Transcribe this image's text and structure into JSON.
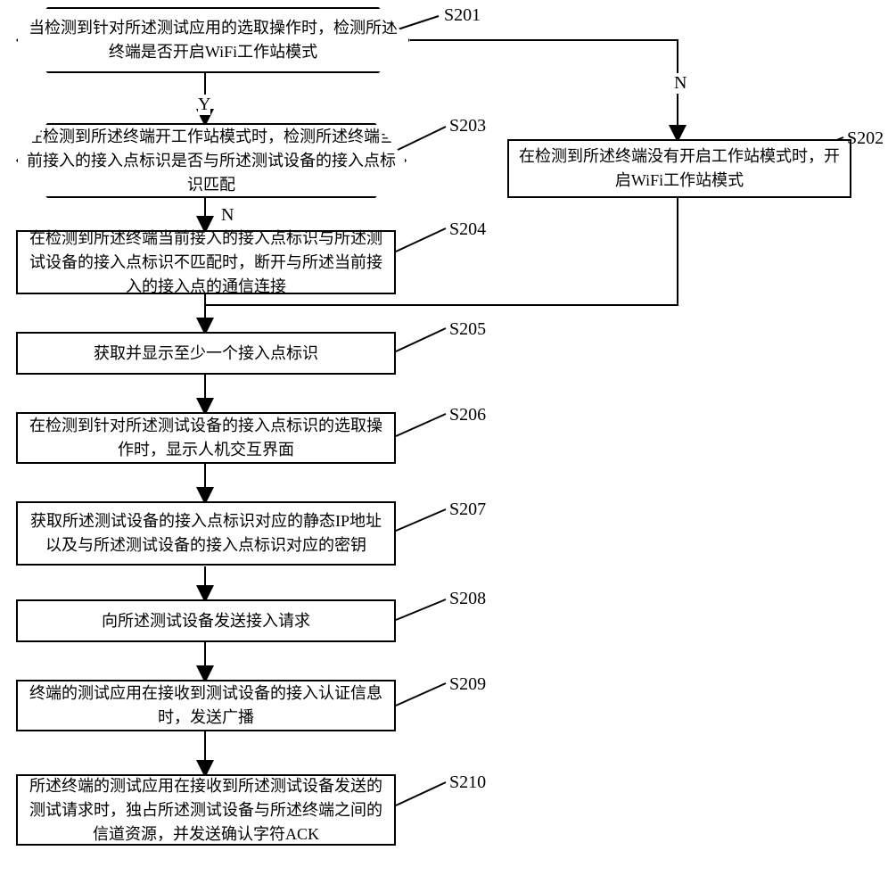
{
  "steps": {
    "s201": {
      "id": "S201",
      "text": "当检测到针对所述测试应用的选取操作时，检测所述终端是否开启WiFi工作站模式"
    },
    "s202": {
      "id": "S202",
      "text": "在检测到所述终端没有开启工作站模式时，开启WiFi工作站模式"
    },
    "s203": {
      "id": "S203",
      "text": "在检测到所述终端开工作站模式时，检测所述终端当前接入的接入点标识是否与所述测试设备的接入点标识匹配"
    },
    "s204": {
      "id": "S204",
      "text": "在检测到所述终端当前接入的接入点标识与所述测试设备的接入点标识不匹配时，断开与所述当前接入的接入点的通信连接"
    },
    "s205": {
      "id": "S205",
      "text": "获取并显示至少一个接入点标识"
    },
    "s206": {
      "id": "S206",
      "text": "在检测到针对所述测试设备的接入点标识的选取操作时，显示人机交互界面"
    },
    "s207": {
      "id": "S207",
      "text": "获取所述测试设备的接入点标识对应的静态IP地址以及与所述测试设备的接入点标识对应的密钥"
    },
    "s208": {
      "id": "S208",
      "text": "向所述测试设备发送接入请求"
    },
    "s209": {
      "id": "S209",
      "text": "终端的测试应用在接收到测试设备的接入认证信息时，发送广播"
    },
    "s210": {
      "id": "S210",
      "text": "所述终端的测试应用在接收到所述测试设备发送的测试请求时，独占所述测试设备与所述终端之间的信道资源，并发送确认字符ACK"
    }
  },
  "labels": {
    "yes": "Y",
    "no": "N"
  },
  "chart_data": {
    "type": "table",
    "description": "Flowchart of WiFi test application connection procedure",
    "nodes": [
      {
        "id": "S201",
        "kind": "decision",
        "text": "当检测到针对所述测试应用的选取操作时，检测所述终端是否开启WiFi工作站模式"
      },
      {
        "id": "S202",
        "kind": "process",
        "text": "在检测到所述终端没有开启工作站模式时，开启WiFi工作站模式"
      },
      {
        "id": "S203",
        "kind": "decision",
        "text": "在检测到所述终端开工作站模式时，检测所述终端当前接入的接入点标识是否与所述测试设备的接入点标识匹配"
      },
      {
        "id": "S204",
        "kind": "process",
        "text": "在检测到所述终端当前接入的接入点标识与所述测试设备的接入点标识不匹配时，断开与所述当前接入的接入点的通信连接"
      },
      {
        "id": "S205",
        "kind": "process",
        "text": "获取并显示至少一个接入点标识"
      },
      {
        "id": "S206",
        "kind": "process",
        "text": "在检测到针对所述测试设备的接入点标识的选取操作时，显示人机交互界面"
      },
      {
        "id": "S207",
        "kind": "process",
        "text": "获取所述测试设备的接入点标识对应的静态IP地址以及与所述测试设备的接入点标识对应的密钥"
      },
      {
        "id": "S208",
        "kind": "process",
        "text": "向所述测试设备发送接入请求"
      },
      {
        "id": "S209",
        "kind": "process",
        "text": "终端的测试应用在接收到测试设备的接入认证信息时，发送广播"
      },
      {
        "id": "S210",
        "kind": "process",
        "text": "所述终端的测试应用在接收到所述测试设备发送的测试请求时，独占所述测试设备与所述终端之间的信道资源，并发送确认字符ACK"
      }
    ],
    "edges": [
      {
        "from": "S201",
        "to": "S203",
        "label": "Y"
      },
      {
        "from": "S201",
        "to": "S202",
        "label": "N"
      },
      {
        "from": "S203",
        "to": "S204",
        "label": "N"
      },
      {
        "from": "S202",
        "to": "S205",
        "label": ""
      },
      {
        "from": "S204",
        "to": "S205",
        "label": ""
      },
      {
        "from": "S205",
        "to": "S206",
        "label": ""
      },
      {
        "from": "S206",
        "to": "S207",
        "label": ""
      },
      {
        "from": "S207",
        "to": "S208",
        "label": ""
      },
      {
        "from": "S208",
        "to": "S209",
        "label": ""
      },
      {
        "from": "S209",
        "to": "S210",
        "label": ""
      }
    ]
  }
}
